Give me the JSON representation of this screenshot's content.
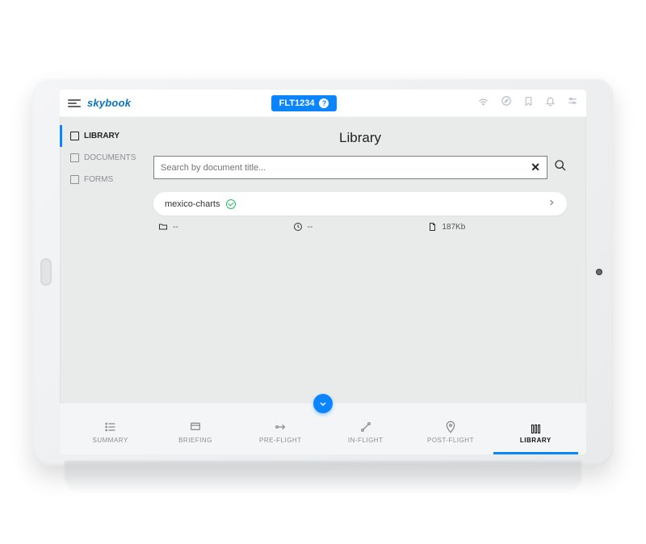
{
  "brand": {
    "name": "skybook"
  },
  "flight": {
    "code": "FLT1234"
  },
  "sidebar": {
    "items": [
      {
        "label": "LIBRARY"
      },
      {
        "label": "DOCUMENTS"
      },
      {
        "label": "FORMS"
      }
    ]
  },
  "page": {
    "title": "Library"
  },
  "search": {
    "placeholder": "Search by document title..."
  },
  "result": {
    "title": "mexico-charts",
    "folder": "--",
    "time": "--",
    "size": "187Kb"
  },
  "tabs": [
    {
      "label": "SUMMARY"
    },
    {
      "label": "BRIEFING"
    },
    {
      "label": "PRE-FLIGHT"
    },
    {
      "label": "IN-FLIGHT"
    },
    {
      "label": "POST-FLIGHT"
    },
    {
      "label": "LIBRARY"
    }
  ]
}
